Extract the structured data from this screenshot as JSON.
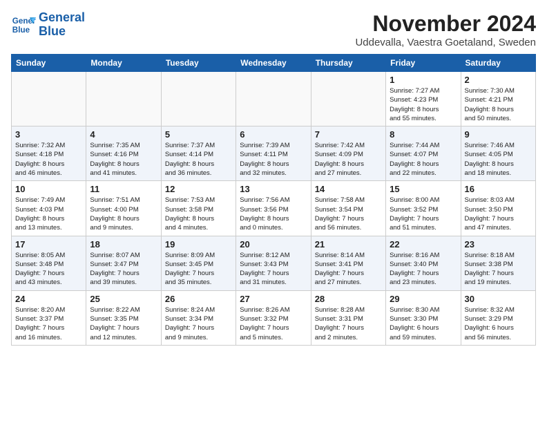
{
  "header": {
    "logo_line1": "General",
    "logo_line2": "Blue",
    "month": "November 2024",
    "location": "Uddevalla, Vaestra Goetaland, Sweden"
  },
  "weekdays": [
    "Sunday",
    "Monday",
    "Tuesday",
    "Wednesday",
    "Thursday",
    "Friday",
    "Saturday"
  ],
  "weeks": [
    [
      {
        "day": "",
        "info": ""
      },
      {
        "day": "",
        "info": ""
      },
      {
        "day": "",
        "info": ""
      },
      {
        "day": "",
        "info": ""
      },
      {
        "day": "",
        "info": ""
      },
      {
        "day": "1",
        "info": "Sunrise: 7:27 AM\nSunset: 4:23 PM\nDaylight: 8 hours\nand 55 minutes."
      },
      {
        "day": "2",
        "info": "Sunrise: 7:30 AM\nSunset: 4:21 PM\nDaylight: 8 hours\nand 50 minutes."
      }
    ],
    [
      {
        "day": "3",
        "info": "Sunrise: 7:32 AM\nSunset: 4:18 PM\nDaylight: 8 hours\nand 46 minutes."
      },
      {
        "day": "4",
        "info": "Sunrise: 7:35 AM\nSunset: 4:16 PM\nDaylight: 8 hours\nand 41 minutes."
      },
      {
        "day": "5",
        "info": "Sunrise: 7:37 AM\nSunset: 4:14 PM\nDaylight: 8 hours\nand 36 minutes."
      },
      {
        "day": "6",
        "info": "Sunrise: 7:39 AM\nSunset: 4:11 PM\nDaylight: 8 hours\nand 32 minutes."
      },
      {
        "day": "7",
        "info": "Sunrise: 7:42 AM\nSunset: 4:09 PM\nDaylight: 8 hours\nand 27 minutes."
      },
      {
        "day": "8",
        "info": "Sunrise: 7:44 AM\nSunset: 4:07 PM\nDaylight: 8 hours\nand 22 minutes."
      },
      {
        "day": "9",
        "info": "Sunrise: 7:46 AM\nSunset: 4:05 PM\nDaylight: 8 hours\nand 18 minutes."
      }
    ],
    [
      {
        "day": "10",
        "info": "Sunrise: 7:49 AM\nSunset: 4:03 PM\nDaylight: 8 hours\nand 13 minutes."
      },
      {
        "day": "11",
        "info": "Sunrise: 7:51 AM\nSunset: 4:00 PM\nDaylight: 8 hours\nand 9 minutes."
      },
      {
        "day": "12",
        "info": "Sunrise: 7:53 AM\nSunset: 3:58 PM\nDaylight: 8 hours\nand 4 minutes."
      },
      {
        "day": "13",
        "info": "Sunrise: 7:56 AM\nSunset: 3:56 PM\nDaylight: 8 hours\nand 0 minutes."
      },
      {
        "day": "14",
        "info": "Sunrise: 7:58 AM\nSunset: 3:54 PM\nDaylight: 7 hours\nand 56 minutes."
      },
      {
        "day": "15",
        "info": "Sunrise: 8:00 AM\nSunset: 3:52 PM\nDaylight: 7 hours\nand 51 minutes."
      },
      {
        "day": "16",
        "info": "Sunrise: 8:03 AM\nSunset: 3:50 PM\nDaylight: 7 hours\nand 47 minutes."
      }
    ],
    [
      {
        "day": "17",
        "info": "Sunrise: 8:05 AM\nSunset: 3:48 PM\nDaylight: 7 hours\nand 43 minutes."
      },
      {
        "day": "18",
        "info": "Sunrise: 8:07 AM\nSunset: 3:47 PM\nDaylight: 7 hours\nand 39 minutes."
      },
      {
        "day": "19",
        "info": "Sunrise: 8:09 AM\nSunset: 3:45 PM\nDaylight: 7 hours\nand 35 minutes."
      },
      {
        "day": "20",
        "info": "Sunrise: 8:12 AM\nSunset: 3:43 PM\nDaylight: 7 hours\nand 31 minutes."
      },
      {
        "day": "21",
        "info": "Sunrise: 8:14 AM\nSunset: 3:41 PM\nDaylight: 7 hours\nand 27 minutes."
      },
      {
        "day": "22",
        "info": "Sunrise: 8:16 AM\nSunset: 3:40 PM\nDaylight: 7 hours\nand 23 minutes."
      },
      {
        "day": "23",
        "info": "Sunrise: 8:18 AM\nSunset: 3:38 PM\nDaylight: 7 hours\nand 19 minutes."
      }
    ],
    [
      {
        "day": "24",
        "info": "Sunrise: 8:20 AM\nSunset: 3:37 PM\nDaylight: 7 hours\nand 16 minutes."
      },
      {
        "day": "25",
        "info": "Sunrise: 8:22 AM\nSunset: 3:35 PM\nDaylight: 7 hours\nand 12 minutes."
      },
      {
        "day": "26",
        "info": "Sunrise: 8:24 AM\nSunset: 3:34 PM\nDaylight: 7 hours\nand 9 minutes."
      },
      {
        "day": "27",
        "info": "Sunrise: 8:26 AM\nSunset: 3:32 PM\nDaylight: 7 hours\nand 5 minutes."
      },
      {
        "day": "28",
        "info": "Sunrise: 8:28 AM\nSunset: 3:31 PM\nDaylight: 7 hours\nand 2 minutes."
      },
      {
        "day": "29",
        "info": "Sunrise: 8:30 AM\nSunset: 3:30 PM\nDaylight: 6 hours\nand 59 minutes."
      },
      {
        "day": "30",
        "info": "Sunrise: 8:32 AM\nSunset: 3:29 PM\nDaylight: 6 hours\nand 56 minutes."
      }
    ]
  ]
}
